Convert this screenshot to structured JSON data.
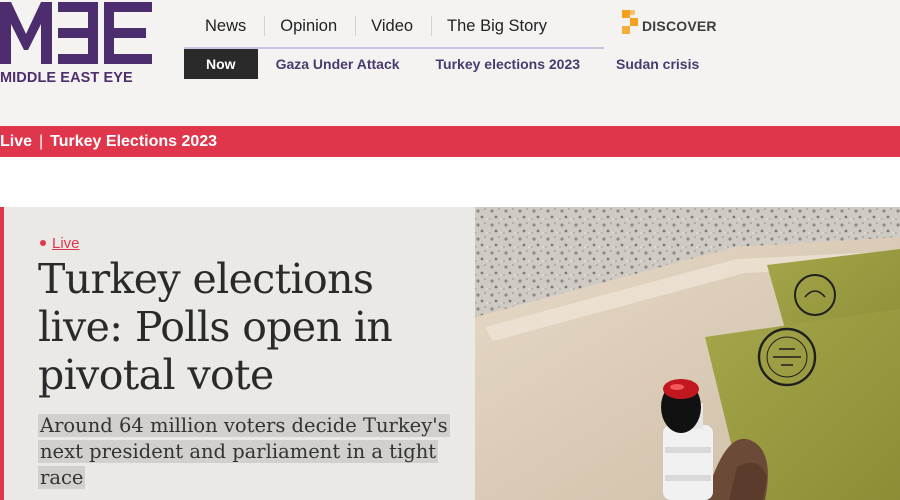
{
  "brand": {
    "name": "MIDDLE EAST EYE",
    "logo_mark": "MEE",
    "purple": "#4d2d6d",
    "accent_red": "#e0364c",
    "discover_orange": "#f4a11f"
  },
  "nav": {
    "main": [
      "News",
      "Opinion",
      "Video",
      "The Big Story"
    ],
    "discover_label": "DISCOVER",
    "discover_icon": "discover-icon",
    "now_label": "Now",
    "sub": [
      "Gaza Under Attack",
      "Turkey elections 2023",
      "Sudan crisis"
    ]
  },
  "banner": {
    "prefix": "Live",
    "separator": "|",
    "title": "Turkey Elections 2023"
  },
  "article": {
    "live_label": "Live",
    "headline": "Turkey elections live: Polls open in pivotal vote",
    "standfirst": "Around 64 million voters decide Turkey's next president and parliament in a tight race",
    "image_icon": "ballot-photo"
  }
}
